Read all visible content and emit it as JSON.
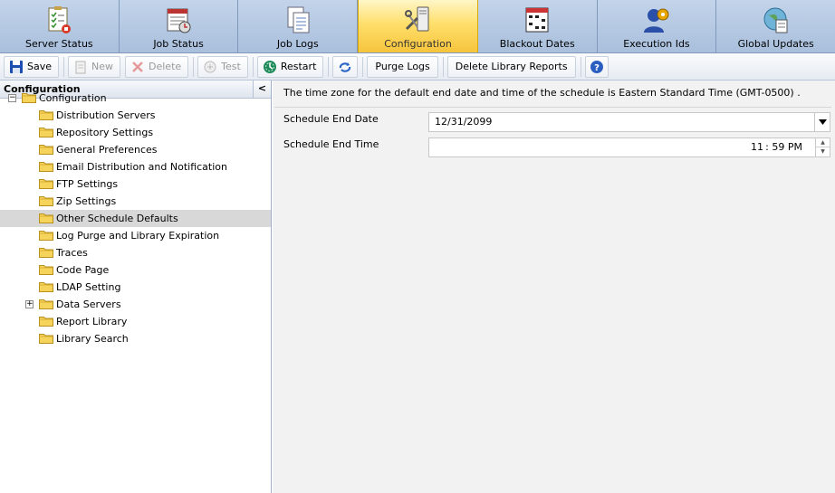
{
  "tabs": [
    {
      "label": "Server Status",
      "icon": "server-status-icon"
    },
    {
      "label": "Job Status",
      "icon": "job-status-icon"
    },
    {
      "label": "Job Logs",
      "icon": "job-logs-icon"
    },
    {
      "label": "Configuration",
      "icon": "configuration-icon",
      "active": true
    },
    {
      "label": "Blackout Dates",
      "icon": "calendar-icon"
    },
    {
      "label": "Execution Ids",
      "icon": "user-gear-icon"
    },
    {
      "label": "Global Updates",
      "icon": "globe-update-icon"
    }
  ],
  "toolbar": {
    "save": "Save",
    "new": "New",
    "delete": "Delete",
    "test": "Test",
    "restart": "Restart",
    "purge_logs": "Purge Logs",
    "delete_library_reports": "Delete Library Reports"
  },
  "tree": {
    "header": "Configuration",
    "collapse_glyph": "<",
    "root": "Configuration",
    "items": [
      "Distribution Servers",
      "Repository Settings",
      "General Preferences",
      "Email Distribution and Notification",
      "FTP Settings",
      "Zip Settings",
      "Other Schedule Defaults",
      "Log Purge and Library Expiration",
      "Traces",
      "Code Page",
      "LDAP Setting",
      "Data Servers",
      "Report Library",
      "Library Search"
    ],
    "selected": "Other Schedule Defaults",
    "expandable": "Data Servers"
  },
  "content": {
    "timezone_note": "The time zone for the default end date and time of the schedule is Eastern Standard Time (GMT-0500) .",
    "end_date_label": "Schedule End Date",
    "end_date_value": "12/31/2099",
    "end_time_label": "Schedule End Time",
    "end_time_value": "11 : 59 PM"
  },
  "colors": {
    "tab_bg": "#aac0dd",
    "tab_active": "#ffdf6b",
    "selected_row": "#d8d8d8",
    "folder": "#f2c94c"
  }
}
